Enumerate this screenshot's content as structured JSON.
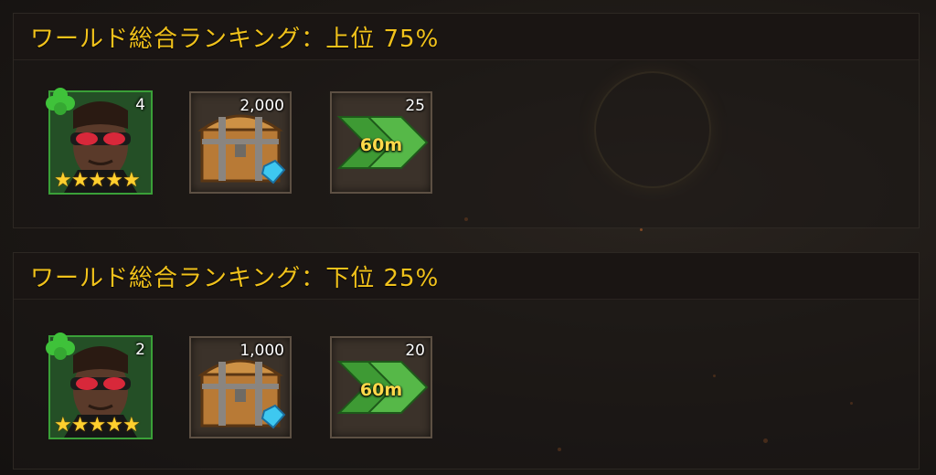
{
  "panels": [
    {
      "title": "ワールド総合ランキング：上位 75%",
      "rewards": {
        "hero_count": "4",
        "chest_count": "2,000",
        "speedup_count": "25",
        "speedup_label": "60m"
      }
    },
    {
      "title": "ワールド総合ランキング：下位 25%",
      "rewards": {
        "hero_count": "2",
        "chest_count": "1,000",
        "speedup_count": "20",
        "speedup_label": "60m"
      }
    }
  ],
  "hero_stars": 5,
  "colors": {
    "title": "#f1c21b",
    "hero_border": "#3aa038",
    "speedup_label": "#ffd94a"
  },
  "icons": [
    "hero-portrait-icon",
    "clover-icon",
    "star-icon",
    "treasure-chest-icon",
    "gem-icon",
    "speedup-arrow-icon"
  ]
}
